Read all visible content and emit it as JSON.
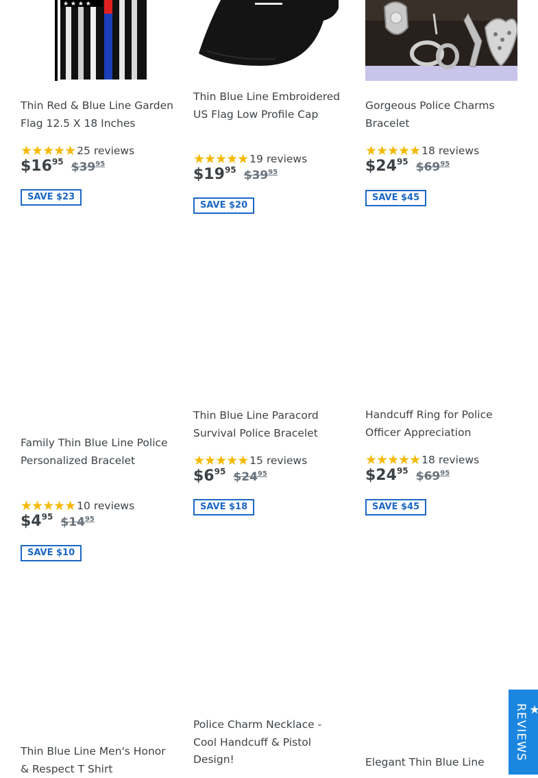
{
  "products": [
    {
      "title": "Thin Red & Blue Line Garden Flag 12.5 X 18 Inches",
      "stars": "★★★★★",
      "reviews": "25 reviews",
      "price_main": "$16",
      "price_cents": "95",
      "compare_main": "$39",
      "compare_cents": "95",
      "save": "SAVE $23"
    },
    {
      "title": "Thin Blue Line Embroidered US Flag Low Profile Cap",
      "stars": "★★★★★",
      "reviews": "19 reviews",
      "price_main": "$19",
      "price_cents": "95",
      "compare_main": "$39",
      "compare_cents": "95",
      "save": "SAVE $20"
    },
    {
      "title": "Gorgeous Police Charms Bracelet",
      "stars": "★★★★★",
      "reviews": "18 reviews",
      "price_main": "$24",
      "price_cents": "95",
      "compare_main": "$69",
      "compare_cents": "95",
      "save": "SAVE $45"
    },
    {
      "title": "Family Thin Blue Line Police Personalized Bracelet",
      "stars": "★★★★★",
      "reviews": "10 reviews",
      "price_main": "$4",
      "price_cents": "95",
      "compare_main": "$14",
      "compare_cents": "95",
      "save": "SAVE $10"
    },
    {
      "title": "Thin Blue Line Paracord Survival Police Bracelet",
      "stars": "★★★★★",
      "reviews": "15 reviews",
      "price_main": "$6",
      "price_cents": "95",
      "compare_main": "$24",
      "compare_cents": "95",
      "save": "SAVE $18"
    },
    {
      "title": "Handcuff Ring for Police Officer Appreciation",
      "stars": "★★★★★",
      "reviews": "18 reviews",
      "price_main": "$24",
      "price_cents": "95",
      "compare_main": "$69",
      "compare_cents": "95",
      "save": "SAVE $45"
    },
    {
      "title": "Thin Blue Line Men's Honor & Respect T Shirt"
    },
    {
      "title": "Police Charm Necklace - Cool Handcuff & Pistol Design!"
    },
    {
      "title": "Elegant Thin Blue Line"
    }
  ],
  "reviews_tab": {
    "label": "★ REVIEWS"
  },
  "colors": {
    "accent": "#1b67c4",
    "star": "#f5b800",
    "badge_bg": "#1b86e0"
  }
}
